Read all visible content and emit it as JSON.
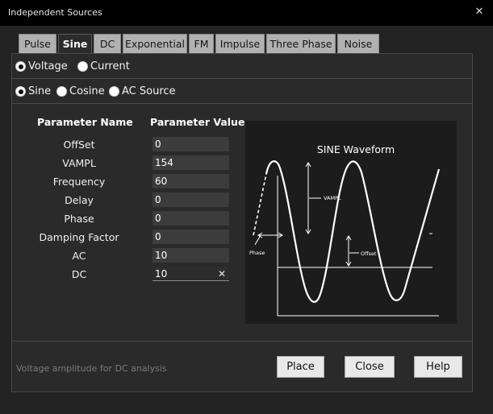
{
  "window": {
    "title": "Independent Sources",
    "close_glyph": "✕"
  },
  "tabs": [
    {
      "label": "Pulse",
      "active": false
    },
    {
      "label": "Sine",
      "active": true
    },
    {
      "label": "DC",
      "active": false
    },
    {
      "label": "Exponential",
      "active": false
    },
    {
      "label": "FM",
      "active": false
    },
    {
      "label": "Impulse",
      "active": false
    },
    {
      "label": "Three Phase",
      "active": false
    },
    {
      "label": "Noise",
      "active": false
    }
  ],
  "source_type": {
    "selected": "Voltage",
    "options": [
      {
        "label": "Voltage"
      },
      {
        "label": "Current"
      }
    ]
  },
  "waveform_type": {
    "selected": "Sine",
    "options": [
      {
        "label": "Sine"
      },
      {
        "label": "Cosine"
      },
      {
        "label": "AC Source"
      }
    ]
  },
  "params": {
    "header_name": "Parameter Name",
    "header_value": "Parameter Value",
    "rows": [
      {
        "label": "OffSet",
        "value": "0"
      },
      {
        "label": "VAMPL",
        "value": "154"
      },
      {
        "label": "Frequency",
        "value": "60"
      },
      {
        "label": "Delay",
        "value": "0"
      },
      {
        "label": "Phase",
        "value": "0"
      },
      {
        "label": "Damping Factor",
        "value": "0"
      },
      {
        "label": "AC",
        "value": "10"
      },
      {
        "label": "DC",
        "value": "10"
      }
    ],
    "clear_glyph": "✕"
  },
  "diagram": {
    "title": "SINE Waveform",
    "vampl_label": "VAMPL",
    "offset_label": "Offset",
    "phase_label": "Phase"
  },
  "status": {
    "text": "Voltage amplitude for DC analysis"
  },
  "buttons": {
    "place": "Place",
    "close": "Close",
    "help": "Help"
  },
  "colors": {
    "background": "#232323",
    "titlebar": "#000000",
    "tab_inactive": "#b1b1b1",
    "status": "#7b7b7b"
  }
}
